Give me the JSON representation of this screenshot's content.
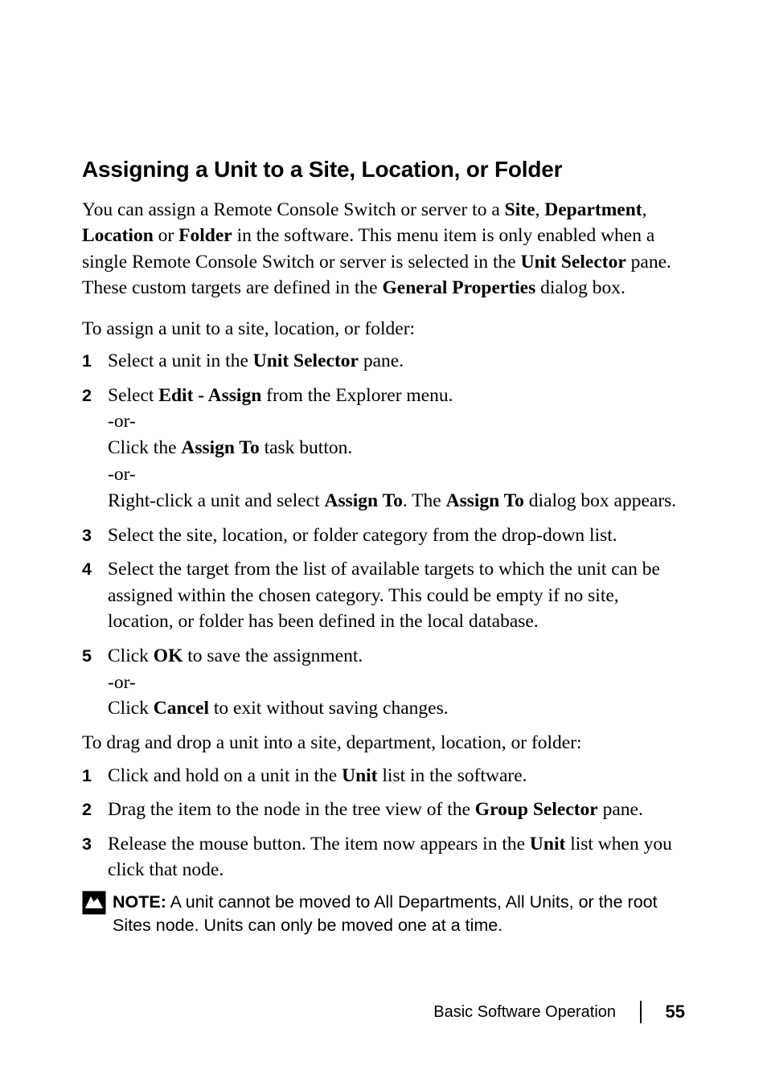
{
  "heading": "Assigning a Unit to a Site, Location, or Folder",
  "intro_parts": {
    "p1": "You can assign a Remote Console Switch or server to a ",
    "b1": "Site",
    "p2": ", ",
    "b2": "Department",
    "p3": ", ",
    "b3": "Location",
    "p4": " or ",
    "b4": "Folder",
    "p5": " in the software. This menu item is only enabled when a single Remote Console Switch or server is selected in the ",
    "b5": "Unit Selector",
    "p6": " pane. These custom targets are defined in the ",
    "b6": "General Properties",
    "p7": " dialog box."
  },
  "lead1": "To assign a unit to a site, location, or folder:",
  "steps1": {
    "n1": "1",
    "s1": {
      "a": "Select a unit in the ",
      "b": "Unit Selector",
      "c": " pane."
    },
    "n2": "2",
    "s2": {
      "a": "Select ",
      "b": "Edit - Assign",
      "c": " from the Explorer menu.",
      "or1": "-or-",
      "d": "Click the ",
      "e": "Assign To",
      "f": " task button.",
      "or2": "-or-",
      "g": "Right-click a unit and select ",
      "h": "Assign To",
      "i": ". The ",
      "j": "Assign To",
      "k": " dialog box appears."
    },
    "n3": "3",
    "s3": "Select the site, location, or folder category from the drop-down list.",
    "n4": "4",
    "s4": "Select the target from the list of available targets to which the unit can be assigned within the chosen category. This could be empty if no site, location, or folder has been defined in the local database.",
    "n5": "5",
    "s5": {
      "a": "Click ",
      "b": "OK",
      "c": " to save the assignment.",
      "or": "-or-",
      "d": "Click ",
      "e": "Cancel",
      "f": " to exit without saving changes."
    }
  },
  "lead2": "To drag and drop a unit into a site, department, location, or folder:",
  "steps2": {
    "n1": "1",
    "s1": {
      "a": "Click and hold on a unit in the ",
      "b": "Unit",
      "c": " list in the software."
    },
    "n2": "2",
    "s2": {
      "a": "Drag the item to the node in the tree view of the ",
      "b": "Group Selector",
      "c": " pane."
    },
    "n3": "3",
    "s3": {
      "a": "Release the mouse button. The item now appears in the ",
      "b": "Unit",
      "c": " list when you click that node."
    }
  },
  "note": {
    "label": "NOTE:",
    "text": " A unit cannot be moved to All Departments, All Units, or the root Sites node. Units can only be moved one at a time."
  },
  "footer": {
    "section": "Basic Software Operation",
    "page": "55"
  }
}
